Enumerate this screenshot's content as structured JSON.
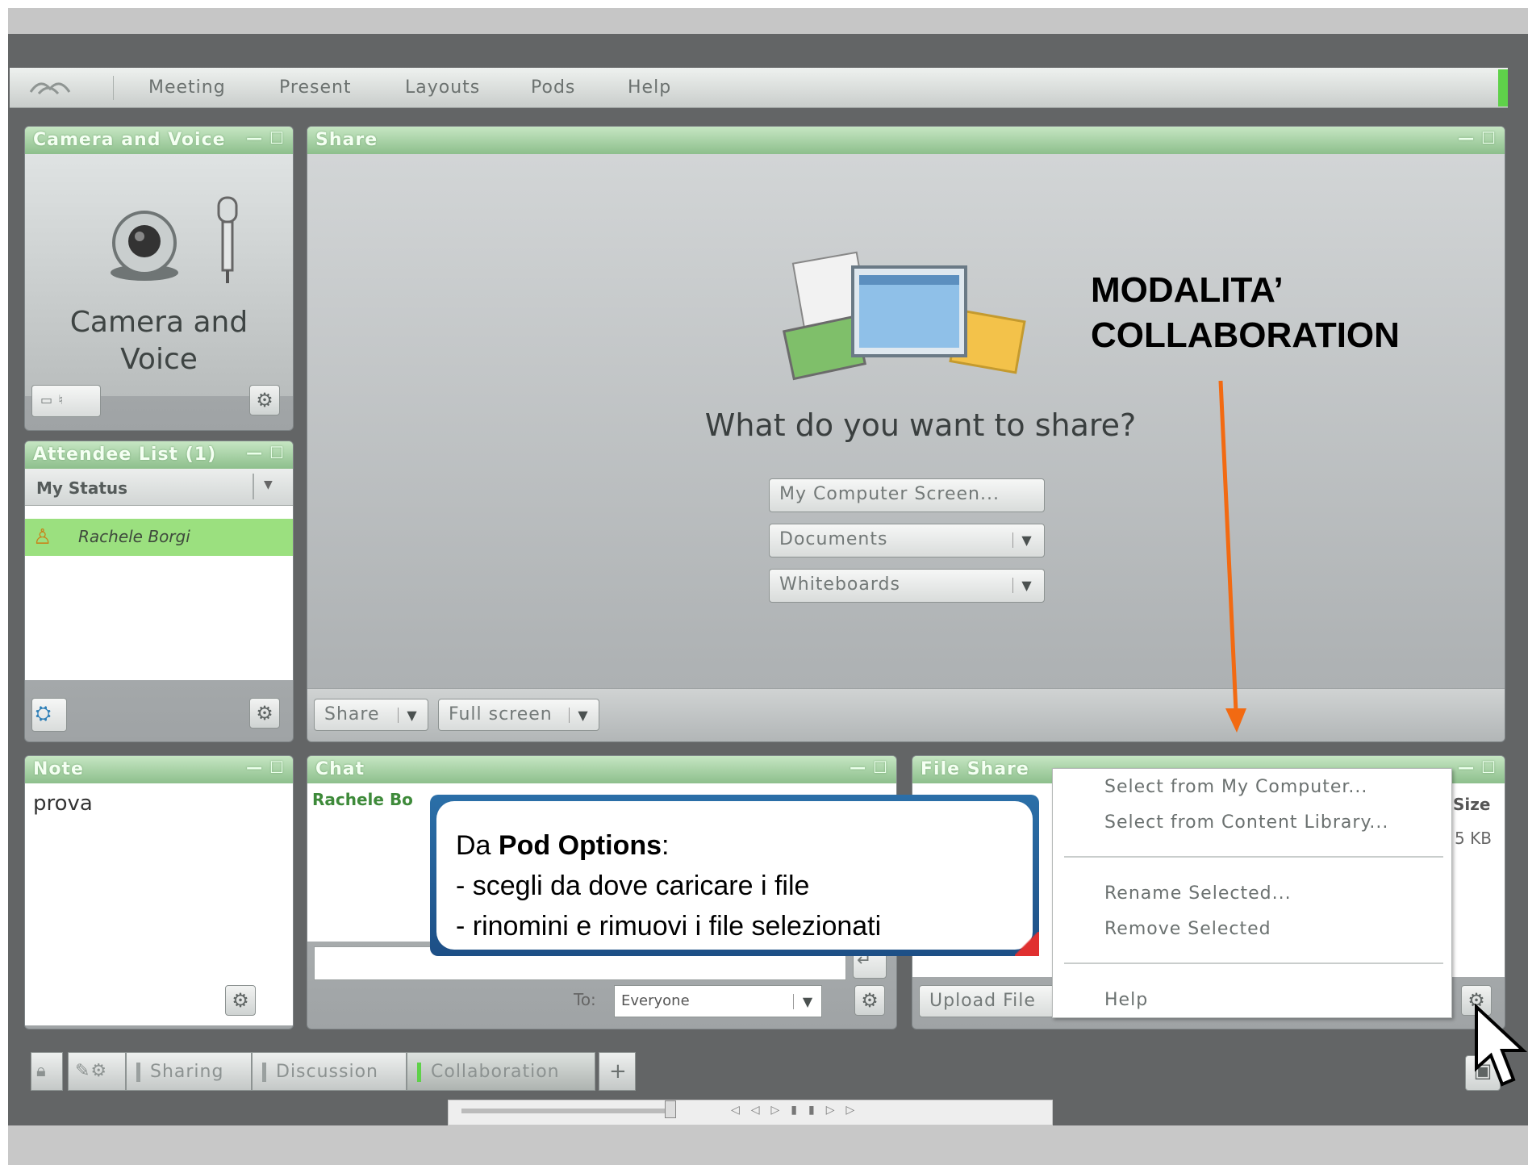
{
  "menu": {
    "items": [
      "Meeting",
      "Present",
      "Layouts",
      "Pods",
      "Help"
    ]
  },
  "camera_pod": {
    "title": "Camera and Voice",
    "placeholder_text": "Camera and Voice"
  },
  "attendee_pod": {
    "title": "Attendee List (1)",
    "status_label": "My Status",
    "attendees": [
      "Rachele Borgi"
    ]
  },
  "share_pod": {
    "title": "Share",
    "prompt": "What do you want to share?",
    "options": [
      "My Computer Screen...",
      "Documents",
      "Whiteboards"
    ],
    "footer_share": "Share",
    "footer_fullscreen": "Full screen"
  },
  "note_pod": {
    "title": "Note",
    "content": "prova"
  },
  "chat_pod": {
    "title": "Chat",
    "sender": "Rachele Bo",
    "to_label": "To:",
    "to_value": "Everyone"
  },
  "fileshare_pod": {
    "title": "File Share",
    "col_size": "Size",
    "size_value": "5 KB",
    "upload_label": "Upload File"
  },
  "context_menu": {
    "select_computer": "Select from My Computer...",
    "select_library": "Select from Content Library...",
    "rename": "Rename Selected...",
    "remove": "Remove Selected",
    "help": "Help"
  },
  "annotation": {
    "title_line1": "MODALITA’",
    "title_line2": "COLLABORATION",
    "arrow_color": "#f26a12"
  },
  "callout": {
    "prefix": "Da ",
    "bold": "Pod Options",
    "suffix": ":",
    "line2": "- scegli da dove caricare i file",
    "line3": "- rinomini e rimuovi i file selezionati"
  },
  "layout_tabs": [
    "Sharing",
    "Discussion",
    "Collaboration"
  ],
  "colors": {
    "pod_title_green": "#8dbf8c",
    "selected_attendee": "#9be07f",
    "active_tab_green": "#5fd14a"
  }
}
